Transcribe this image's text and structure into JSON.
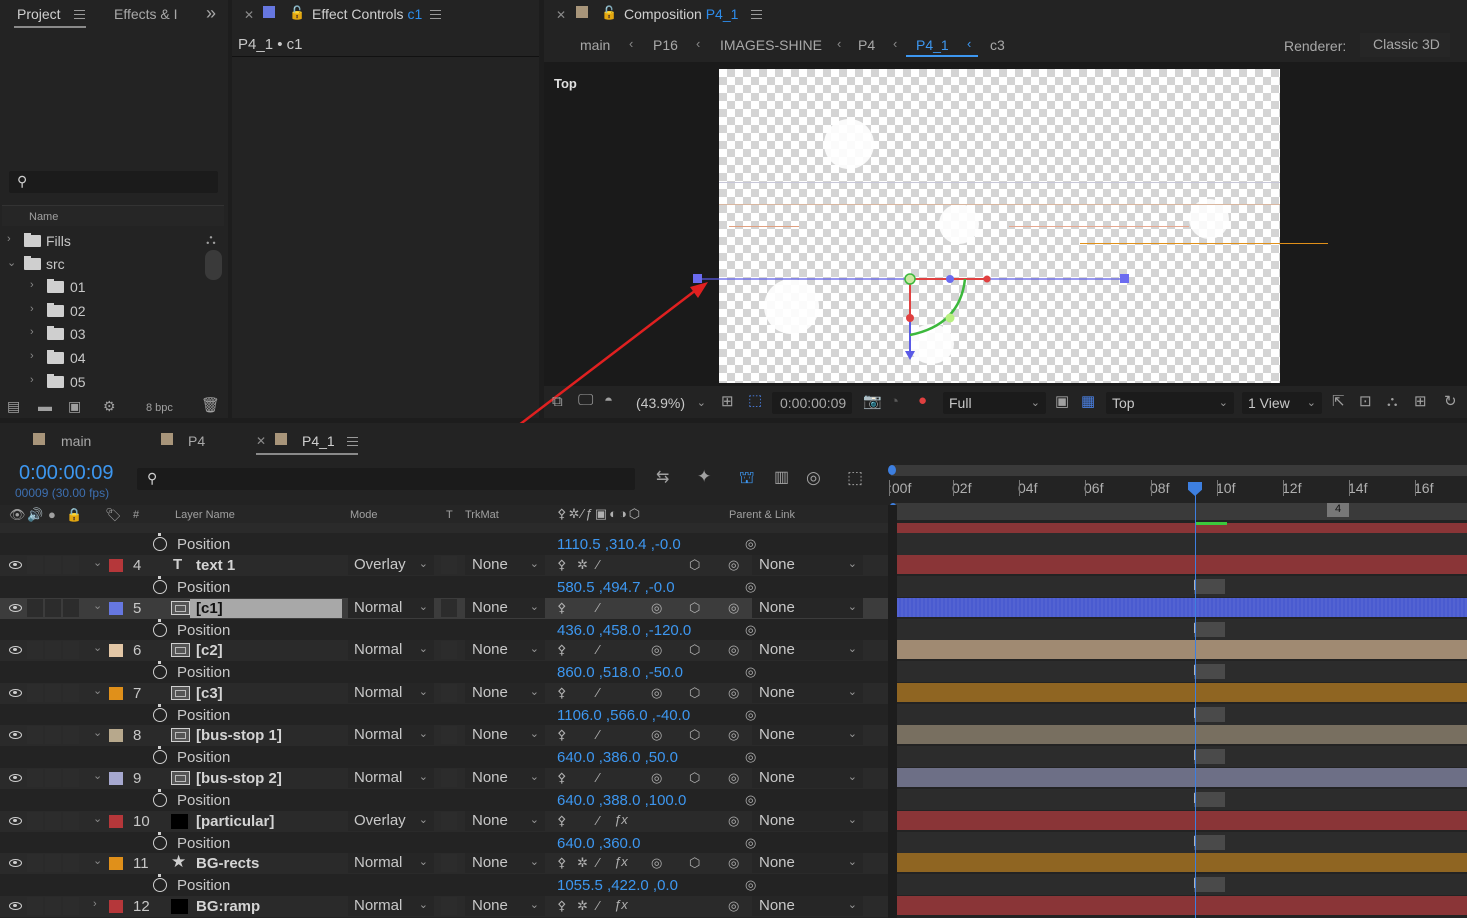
{
  "project_panel": {
    "tab_project": "Project",
    "tab_effects": "Effects & I",
    "overflow": "»",
    "column_name": "Name",
    "tree": [
      {
        "label": "Fills",
        "level": 0,
        "expanded": false
      },
      {
        "label": "src",
        "level": 0,
        "expanded": true
      },
      {
        "label": "01",
        "level": 1,
        "expanded": false
      },
      {
        "label": "02",
        "level": 1,
        "expanded": false
      },
      {
        "label": "03",
        "level": 1,
        "expanded": false
      },
      {
        "label": "04",
        "level": 1,
        "expanded": false
      },
      {
        "label": "05",
        "level": 1,
        "expanded": false
      }
    ],
    "bpc": "8 bpc"
  },
  "effect_controls": {
    "tab_prefix": "Effect Controls",
    "tab_layer": "c1",
    "breadcrumb": "P4_1 • c1"
  },
  "composition": {
    "tab_prefix": "Composition",
    "tab_name": "P4_1",
    "breadcrumbs": [
      "main",
      "P16",
      "IMAGES-SHINE",
      "P4",
      "P4_1",
      "c3"
    ],
    "active_crumb": "P4_1",
    "renderer_label": "Renderer:",
    "renderer_value": "Classic 3D",
    "view_label": "Top",
    "zoom": "(43.9%)",
    "timecode": "0:00:00:09",
    "resolution": "Full",
    "view_dropdown": "Top",
    "views": "1 View"
  },
  "timeline": {
    "tabs": [
      {
        "label": "main",
        "color": "#a8957a",
        "active": false
      },
      {
        "label": "P4",
        "color": "#a8957a",
        "active": false
      },
      {
        "label": "P4_1",
        "color": "#a8957a",
        "active": true
      }
    ],
    "timecode": "0:00:00:09",
    "frame_info": "00009 (30.00 fps)",
    "columns": {
      "num": "#",
      "layer_name": "Layer Name",
      "mode": "Mode",
      "t": "T",
      "trkmat": "TrkMat",
      "parent": "Parent & Link"
    },
    "ruler_ticks": [
      ":00f",
      "02f",
      "04f",
      "06f",
      "08f",
      "10f",
      "12f",
      "14f",
      "16f"
    ],
    "marker_label": "4",
    "top_partial_position": "1110.5 ,310.4 ,-0.0",
    "property_label": "Position",
    "layers": [
      {
        "num": "4",
        "name": "text 1",
        "type": "text",
        "color": "#b5373a",
        "mode": "Overlay",
        "trkmat": "None",
        "parent": "None",
        "position": "580.5 ,494.7 ,-0.0",
        "bar_color": "#8a3537",
        "selected": false
      },
      {
        "num": "5",
        "name": "[c1]",
        "type": "comp",
        "color": "#6677e0",
        "mode": "Normal",
        "trkmat": "None",
        "parent": "None",
        "position": "436.0 ,458.0 ,-120.0",
        "bar_color": "#4a5bd0",
        "selected": true
      },
      {
        "num": "6",
        "name": "[c2]",
        "type": "comp",
        "color": "#e3c7a6",
        "mode": "Normal",
        "trkmat": "None",
        "parent": "None",
        "position": "860.0 ,518.0 ,-50.0",
        "bar_color": "#a08a72",
        "selected": false
      },
      {
        "num": "7",
        "name": "[c3]",
        "type": "comp",
        "color": "#e0901a",
        "mode": "Normal",
        "trkmat": "None",
        "parent": "None",
        "position": "1106.0 ,566.0 ,-40.0",
        "bar_color": "#8f6522",
        "selected": false
      },
      {
        "num": "8",
        "name": "[bus-stop 1]",
        "type": "comp",
        "color": "#b7a88c",
        "mode": "Normal",
        "trkmat": "None",
        "parent": "None",
        "position": "640.0 ,386.0 ,50.0",
        "bar_color": "#786f60",
        "selected": false
      },
      {
        "num": "9",
        "name": "[bus-stop 2]",
        "type": "comp",
        "color": "#a6a8cf",
        "mode": "Normal",
        "trkmat": "None",
        "parent": "None",
        "position": "640.0 ,388.0 ,100.0",
        "bar_color": "#6d6f86",
        "selected": false
      },
      {
        "num": "10",
        "name": "[particular]",
        "type": "solid",
        "color": "#b5373a",
        "mode": "Overlay",
        "trkmat": "None",
        "parent": "None",
        "position": "640.0 ,360.0",
        "bar_color": "#8a3537",
        "selected": false
      },
      {
        "num": "11",
        "name": "BG-rects",
        "type": "shape",
        "color": "#e0901a",
        "mode": "Normal",
        "trkmat": "None",
        "parent": "None",
        "position": "1055.5 ,422.0 ,0.0",
        "bar_color": "#8f6522",
        "selected": false
      },
      {
        "num": "12",
        "name": "BG:ramp",
        "type": "solid",
        "color": "#b5373a",
        "mode": "Normal",
        "trkmat": "None",
        "parent": "None",
        "position": "",
        "bar_color": "#8a3537",
        "selected": false
      }
    ]
  }
}
